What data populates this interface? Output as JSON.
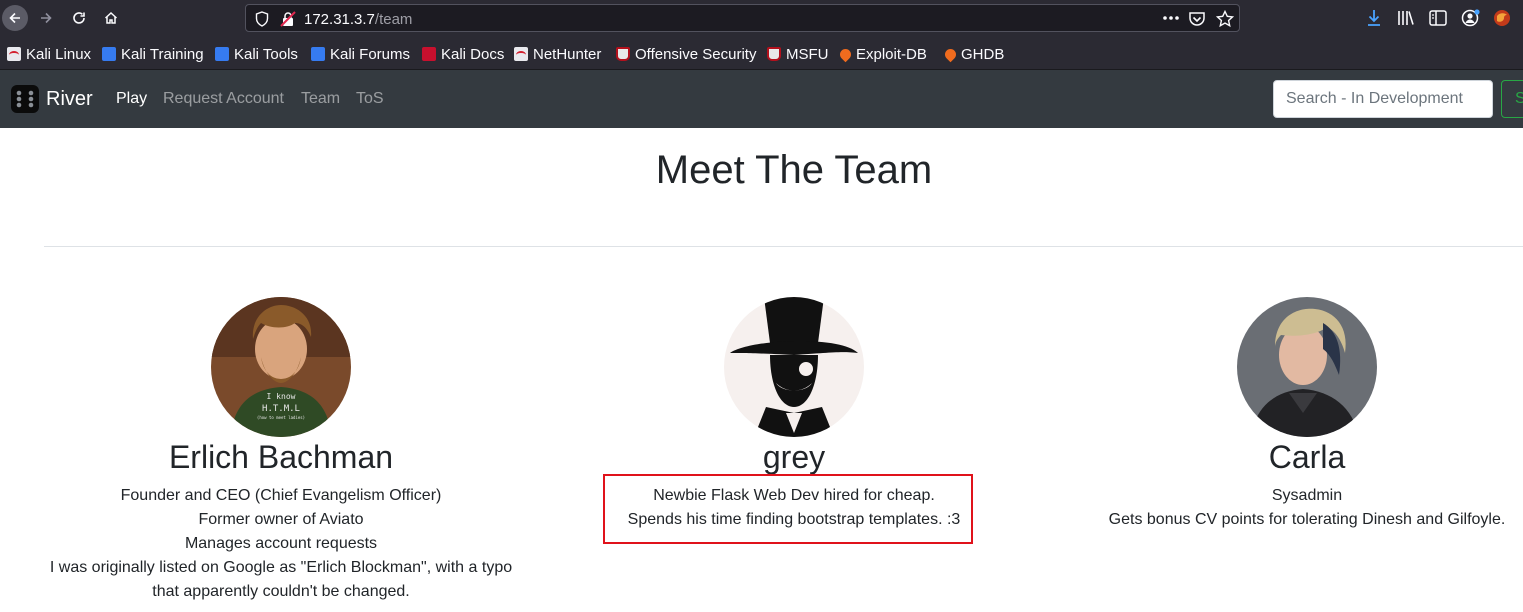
{
  "browser": {
    "url_host": "172.31.3.7",
    "url_path": "/team",
    "bookmarks": [
      {
        "label": "Kali Linux",
        "icon": "kali-icon"
      },
      {
        "label": "Kali Training",
        "icon": "kali-training-icon"
      },
      {
        "label": "Kali Tools",
        "icon": "kali-tools-icon"
      },
      {
        "label": "Kali Forums",
        "icon": "kali-forums-icon"
      },
      {
        "label": "Kali Docs",
        "icon": "kali-docs-icon"
      },
      {
        "label": "NetHunter",
        "icon": "nethunter-icon"
      },
      {
        "label": "Offensive Security",
        "icon": "offsec-icon"
      },
      {
        "label": "MSFU",
        "icon": "msfu-icon"
      },
      {
        "label": "Exploit-DB",
        "icon": "exploitdb-icon"
      },
      {
        "label": "GHDB",
        "icon": "ghdb-icon"
      }
    ]
  },
  "navbar": {
    "brand": "River",
    "links": [
      "Play",
      "Request Account",
      "Team",
      "ToS"
    ],
    "search_placeholder": "Search - In Development",
    "search_button": "S"
  },
  "page": {
    "title": "Meet The Team",
    "members": [
      {
        "name": "Erlich Bachman",
        "lines": [
          "Founder and CEO (Chief Evangelism Officer)",
          "Former owner of Aviato",
          "Manages account requests",
          "I was originally listed on Google as \"Erlich Blockman\", with a typo",
          "that apparently couldn't be changed."
        ],
        "avatar_shirt_text": [
          "I know",
          "H.T.M.L",
          "(how to meet ladies)"
        ]
      },
      {
        "name": "grey",
        "lines": [
          "Newbie Flask Web Dev hired for cheap.",
          "Spends his time finding bootstrap templates. :3"
        ]
      },
      {
        "name": "Carla",
        "lines": [
          "Sysadmin",
          "Gets bonus CV points for tolerating Dinesh and Gilfoyle."
        ]
      }
    ]
  },
  "colors": {
    "chrome_bg": "#2b2a33",
    "navbar_bg": "#343a40",
    "success": "#28a745",
    "highlight": "#e0121b"
  }
}
